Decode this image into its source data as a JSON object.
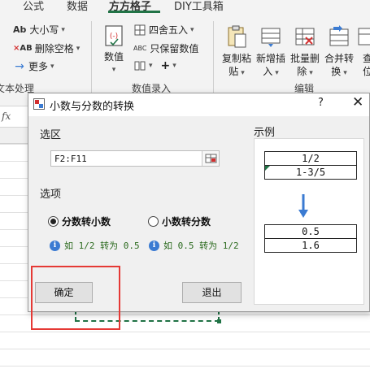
{
  "ribbon": {
    "tabs": [
      "公式",
      "数据",
      "方方格子",
      "DIY工具箱"
    ],
    "active_tab": "方方格子",
    "text_group": {
      "items": [
        "大小写",
        "删除空格",
        "更多"
      ],
      "icon_prefix_1": "Ab",
      "icon_prefix_2": "AB",
      "label": "文本处理"
    },
    "number_group": {
      "big_button": "数值",
      "items": [
        "四舍五入",
        "只保留数值",
        "+"
      ],
      "icon_prefix_2": "ABC",
      "label": "数值录入"
    },
    "edit_group": {
      "buttons": [
        {
          "line1": "复制粘",
          "line2": "贴"
        },
        {
          "line1": "新增插",
          "line2": "入"
        },
        {
          "line1": "批量删",
          "line2": "除"
        },
        {
          "line1": "合并转",
          "line2": "换"
        },
        {
          "line1": "查",
          "line2": "位"
        }
      ],
      "label": "编辑"
    }
  },
  "sheet": {
    "fx_label": "fx",
    "accent": "#217346"
  },
  "dialog": {
    "title": "小数与分数的转换",
    "help": "?",
    "close": "✕",
    "range_section": "选区",
    "range_value": "F2:F11",
    "options_section": "选项",
    "option_1": "分数转小数",
    "option_2": "小数转分数",
    "selected_option": "分数转小数",
    "hint_1": "如 1/2 转为 0.5",
    "hint_2": "如 0.5 转为 1/2",
    "ok_button": "确定",
    "exit_button": "退出",
    "example_section": "示例",
    "example_top": [
      "1/2",
      "1-3/5"
    ],
    "example_bottom": [
      "0.5",
      "1.6"
    ]
  },
  "colors": {
    "highlight": "#e53935",
    "info": "#3b7bd2",
    "arrow": "#3b7bd2",
    "hint_text": "#2b6a1e"
  }
}
